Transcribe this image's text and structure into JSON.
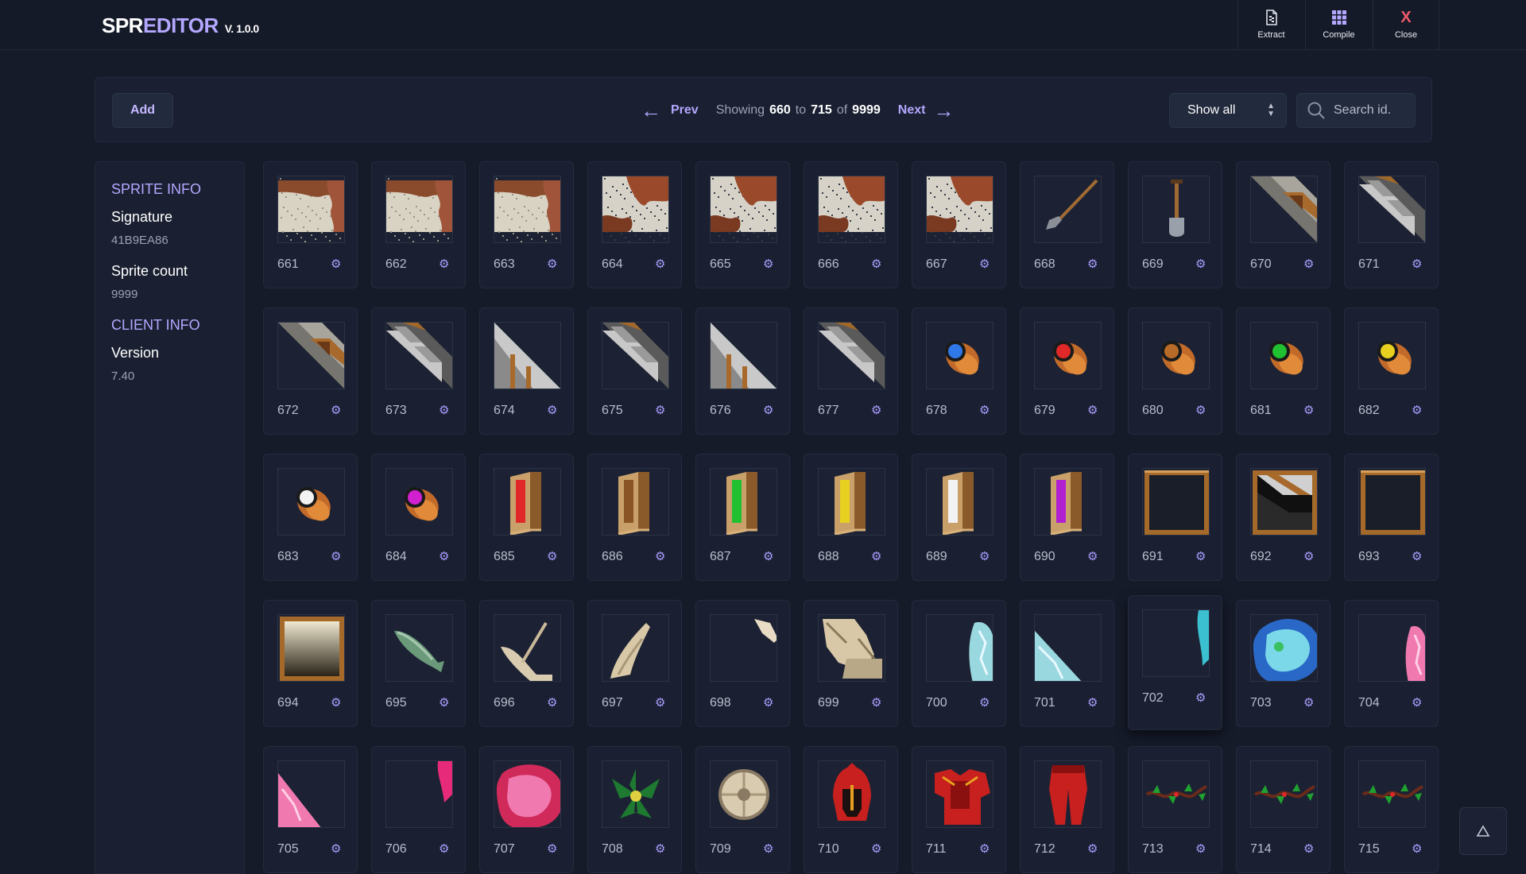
{
  "app": {
    "logo_part1": "SPR",
    "logo_part2": "EDITOR",
    "version": "V. 1.0.0"
  },
  "topbar": {
    "extract_label": "Extract",
    "compile_label": "Compile",
    "close_label": "Close",
    "close_glyph": "X"
  },
  "toolbar": {
    "add_label": "Add",
    "prev_label": "Prev",
    "next_label": "Next",
    "showing_label": "Showing",
    "to_label": "to",
    "of_label": "of",
    "range_start": "660",
    "range_end": "715",
    "total": "9999",
    "filter_value": "Show all",
    "search_placeholder": "Search id."
  },
  "sidebar": {
    "sprite_heading": "SPRITE INFO",
    "signature_label": "Signature",
    "signature_value": "41B9EA86",
    "count_label": "Sprite count",
    "count_value": "9999",
    "client_heading": "CLIENT INFO",
    "version_label": "Version",
    "version_value": "7.40"
  },
  "sprites": [
    {
      "id": "661",
      "kind": "ground-dirt-edge"
    },
    {
      "id": "662",
      "kind": "ground-dirt-edge"
    },
    {
      "id": "663",
      "kind": "ground-dirt-edge"
    },
    {
      "id": "664",
      "kind": "ground-gravel-edge"
    },
    {
      "id": "665",
      "kind": "ground-gravel-edge"
    },
    {
      "id": "666",
      "kind": "ground-gravel-edge"
    },
    {
      "id": "667",
      "kind": "ground-gravel-edge"
    },
    {
      "id": "668",
      "kind": "shovel-diagonal"
    },
    {
      "id": "669",
      "kind": "shovel"
    },
    {
      "id": "670",
      "kind": "rail-diagonal"
    },
    {
      "id": "671",
      "kind": "stone-diagonal"
    },
    {
      "id": "672",
      "kind": "rail-diagonal"
    },
    {
      "id": "673",
      "kind": "stone-diagonal"
    },
    {
      "id": "674",
      "kind": "ramp"
    },
    {
      "id": "675",
      "kind": "stone-diagonal"
    },
    {
      "id": "676",
      "kind": "ramp"
    },
    {
      "id": "677",
      "kind": "stone-diagonal"
    },
    {
      "id": "678",
      "kind": "barrel",
      "color": "#2f78e8"
    },
    {
      "id": "679",
      "kind": "barrel",
      "color": "#e02828"
    },
    {
      "id": "680",
      "kind": "barrel",
      "color": "#b86a28"
    },
    {
      "id": "681",
      "kind": "barrel",
      "color": "#20c030"
    },
    {
      "id": "682",
      "kind": "barrel",
      "color": "#e8d020"
    },
    {
      "id": "683",
      "kind": "barrel",
      "color": "#f2f2f2"
    },
    {
      "id": "684",
      "kind": "barrel",
      "color": "#d020d0"
    },
    {
      "id": "685",
      "kind": "door",
      "color": "#e02828"
    },
    {
      "id": "686",
      "kind": "door",
      "color": "#8a5424"
    },
    {
      "id": "687",
      "kind": "door",
      "color": "#20c030"
    },
    {
      "id": "688",
      "kind": "door",
      "color": "#e8d020"
    },
    {
      "id": "689",
      "kind": "door",
      "color": "#f2f2f2"
    },
    {
      "id": "690",
      "kind": "door",
      "color": "#b020d0"
    },
    {
      "id": "691",
      "kind": "frame-dark"
    },
    {
      "id": "692",
      "kind": "frame-stairs"
    },
    {
      "id": "693",
      "kind": "frame-dark"
    },
    {
      "id": "694",
      "kind": "frame-light"
    },
    {
      "id": "695",
      "kind": "fish"
    },
    {
      "id": "696",
      "kind": "bone-pick"
    },
    {
      "id": "697",
      "kind": "bone-wing"
    },
    {
      "id": "698",
      "kind": "bone-corner"
    },
    {
      "id": "699",
      "kind": "bone-pile"
    },
    {
      "id": "700",
      "kind": "crystal-edge"
    },
    {
      "id": "701",
      "kind": "crystal-corner"
    },
    {
      "id": "702",
      "kind": "crystal-sliver"
    },
    {
      "id": "703",
      "kind": "crystal-blob"
    },
    {
      "id": "704",
      "kind": "pink-edge"
    },
    {
      "id": "705",
      "kind": "pink-corner"
    },
    {
      "id": "706",
      "kind": "pink-sliver"
    },
    {
      "id": "707",
      "kind": "pink-blob"
    },
    {
      "id": "708",
      "kind": "plant"
    },
    {
      "id": "709",
      "kind": "shield"
    },
    {
      "id": "710",
      "kind": "helmet"
    },
    {
      "id": "711",
      "kind": "armor"
    },
    {
      "id": "712",
      "kind": "legs"
    },
    {
      "id": "713",
      "kind": "vine"
    },
    {
      "id": "714",
      "kind": "vine"
    },
    {
      "id": "715",
      "kind": "vine"
    }
  ],
  "colors": {
    "accent": "#b4a7ff",
    "background": "#161b2a",
    "panel": "#1a2031",
    "close": "#f05a6a"
  }
}
